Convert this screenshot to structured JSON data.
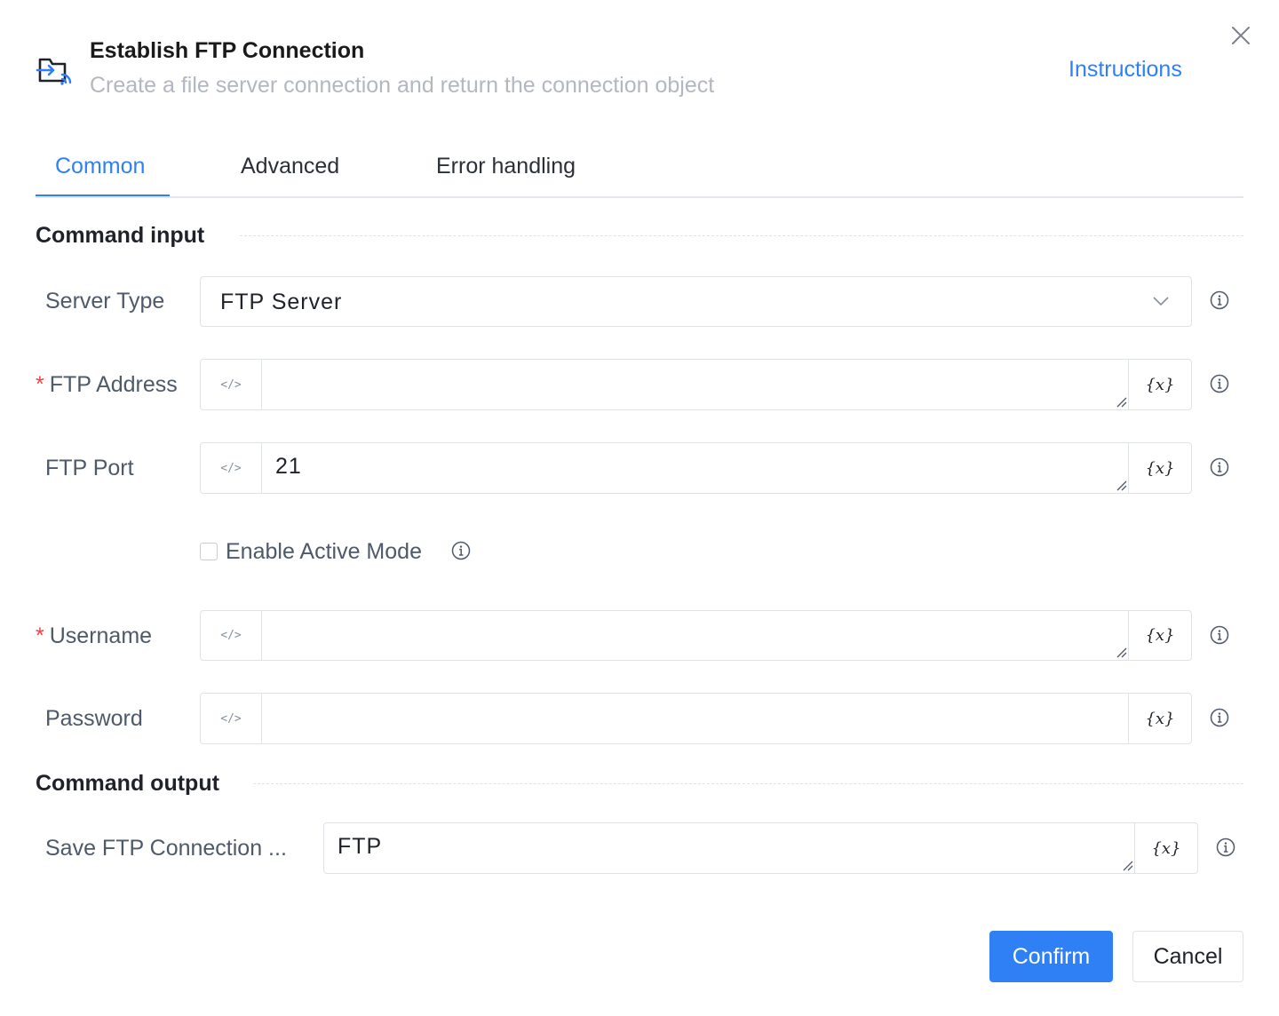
{
  "dialog": {
    "title": "Establish FTP Connection",
    "subtitle": "Create a file server connection and return the connection object",
    "instructions_label": "Instructions",
    "header_icon": "folder-connection-icon",
    "close_icon": "close-icon"
  },
  "tabs": [
    {
      "label": "Common",
      "active": true
    },
    {
      "label": "Advanced",
      "active": false
    },
    {
      "label": "Error handling",
      "active": false
    }
  ],
  "sections": {
    "input_title": "Command input",
    "output_title": "Command output"
  },
  "fields": {
    "server_type": {
      "label": "Server Type",
      "value": "FTP Server",
      "required": false
    },
    "ftp_address": {
      "label": "FTP Address",
      "value": "",
      "required": true
    },
    "ftp_port": {
      "label": "FTP Port",
      "value": "21",
      "required": false
    },
    "active_mode": {
      "label": "Enable Active Mode",
      "checked": false
    },
    "username": {
      "label": "Username",
      "value": "",
      "required": true
    },
    "password": {
      "label": "Password",
      "value": "",
      "required": false
    },
    "save_connection": {
      "label": "Save FTP Connection ...",
      "value": "FTP"
    }
  },
  "common": {
    "required_mark": "*",
    "code_glyph": "</>",
    "variable_glyph": "{x}"
  },
  "footer": {
    "confirm_label": "Confirm",
    "cancel_label": "Cancel"
  },
  "colors": {
    "accent": "#2f80f5",
    "required": "#f53f3f",
    "label": "#4e5969",
    "muted": "#b3b7bf",
    "border": "#dfe2e6"
  }
}
